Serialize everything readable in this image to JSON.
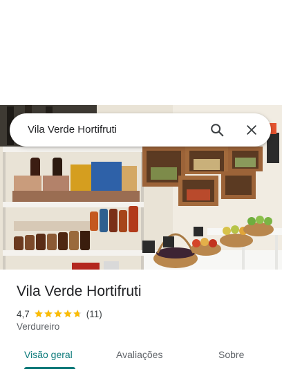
{
  "search": {
    "query": "Vila Verde Hortifruti"
  },
  "icons": {
    "search": "search-icon",
    "close": "close-icon",
    "star": "star-icon"
  },
  "place": {
    "name": "Vila Verde Hortifruti",
    "rating": "4,7",
    "rating_value": 4.7,
    "review_count": "(11)",
    "category": "Verdureiro"
  },
  "tabs": [
    {
      "label": "Visão geral",
      "active": true
    },
    {
      "label": "Avaliações",
      "active": false
    },
    {
      "label": "Sobre",
      "active": false
    }
  ],
  "colors": {
    "accent": "#0b7a7a",
    "star": "#fbbc04",
    "text": "#202124",
    "secondary": "#5f6368"
  }
}
